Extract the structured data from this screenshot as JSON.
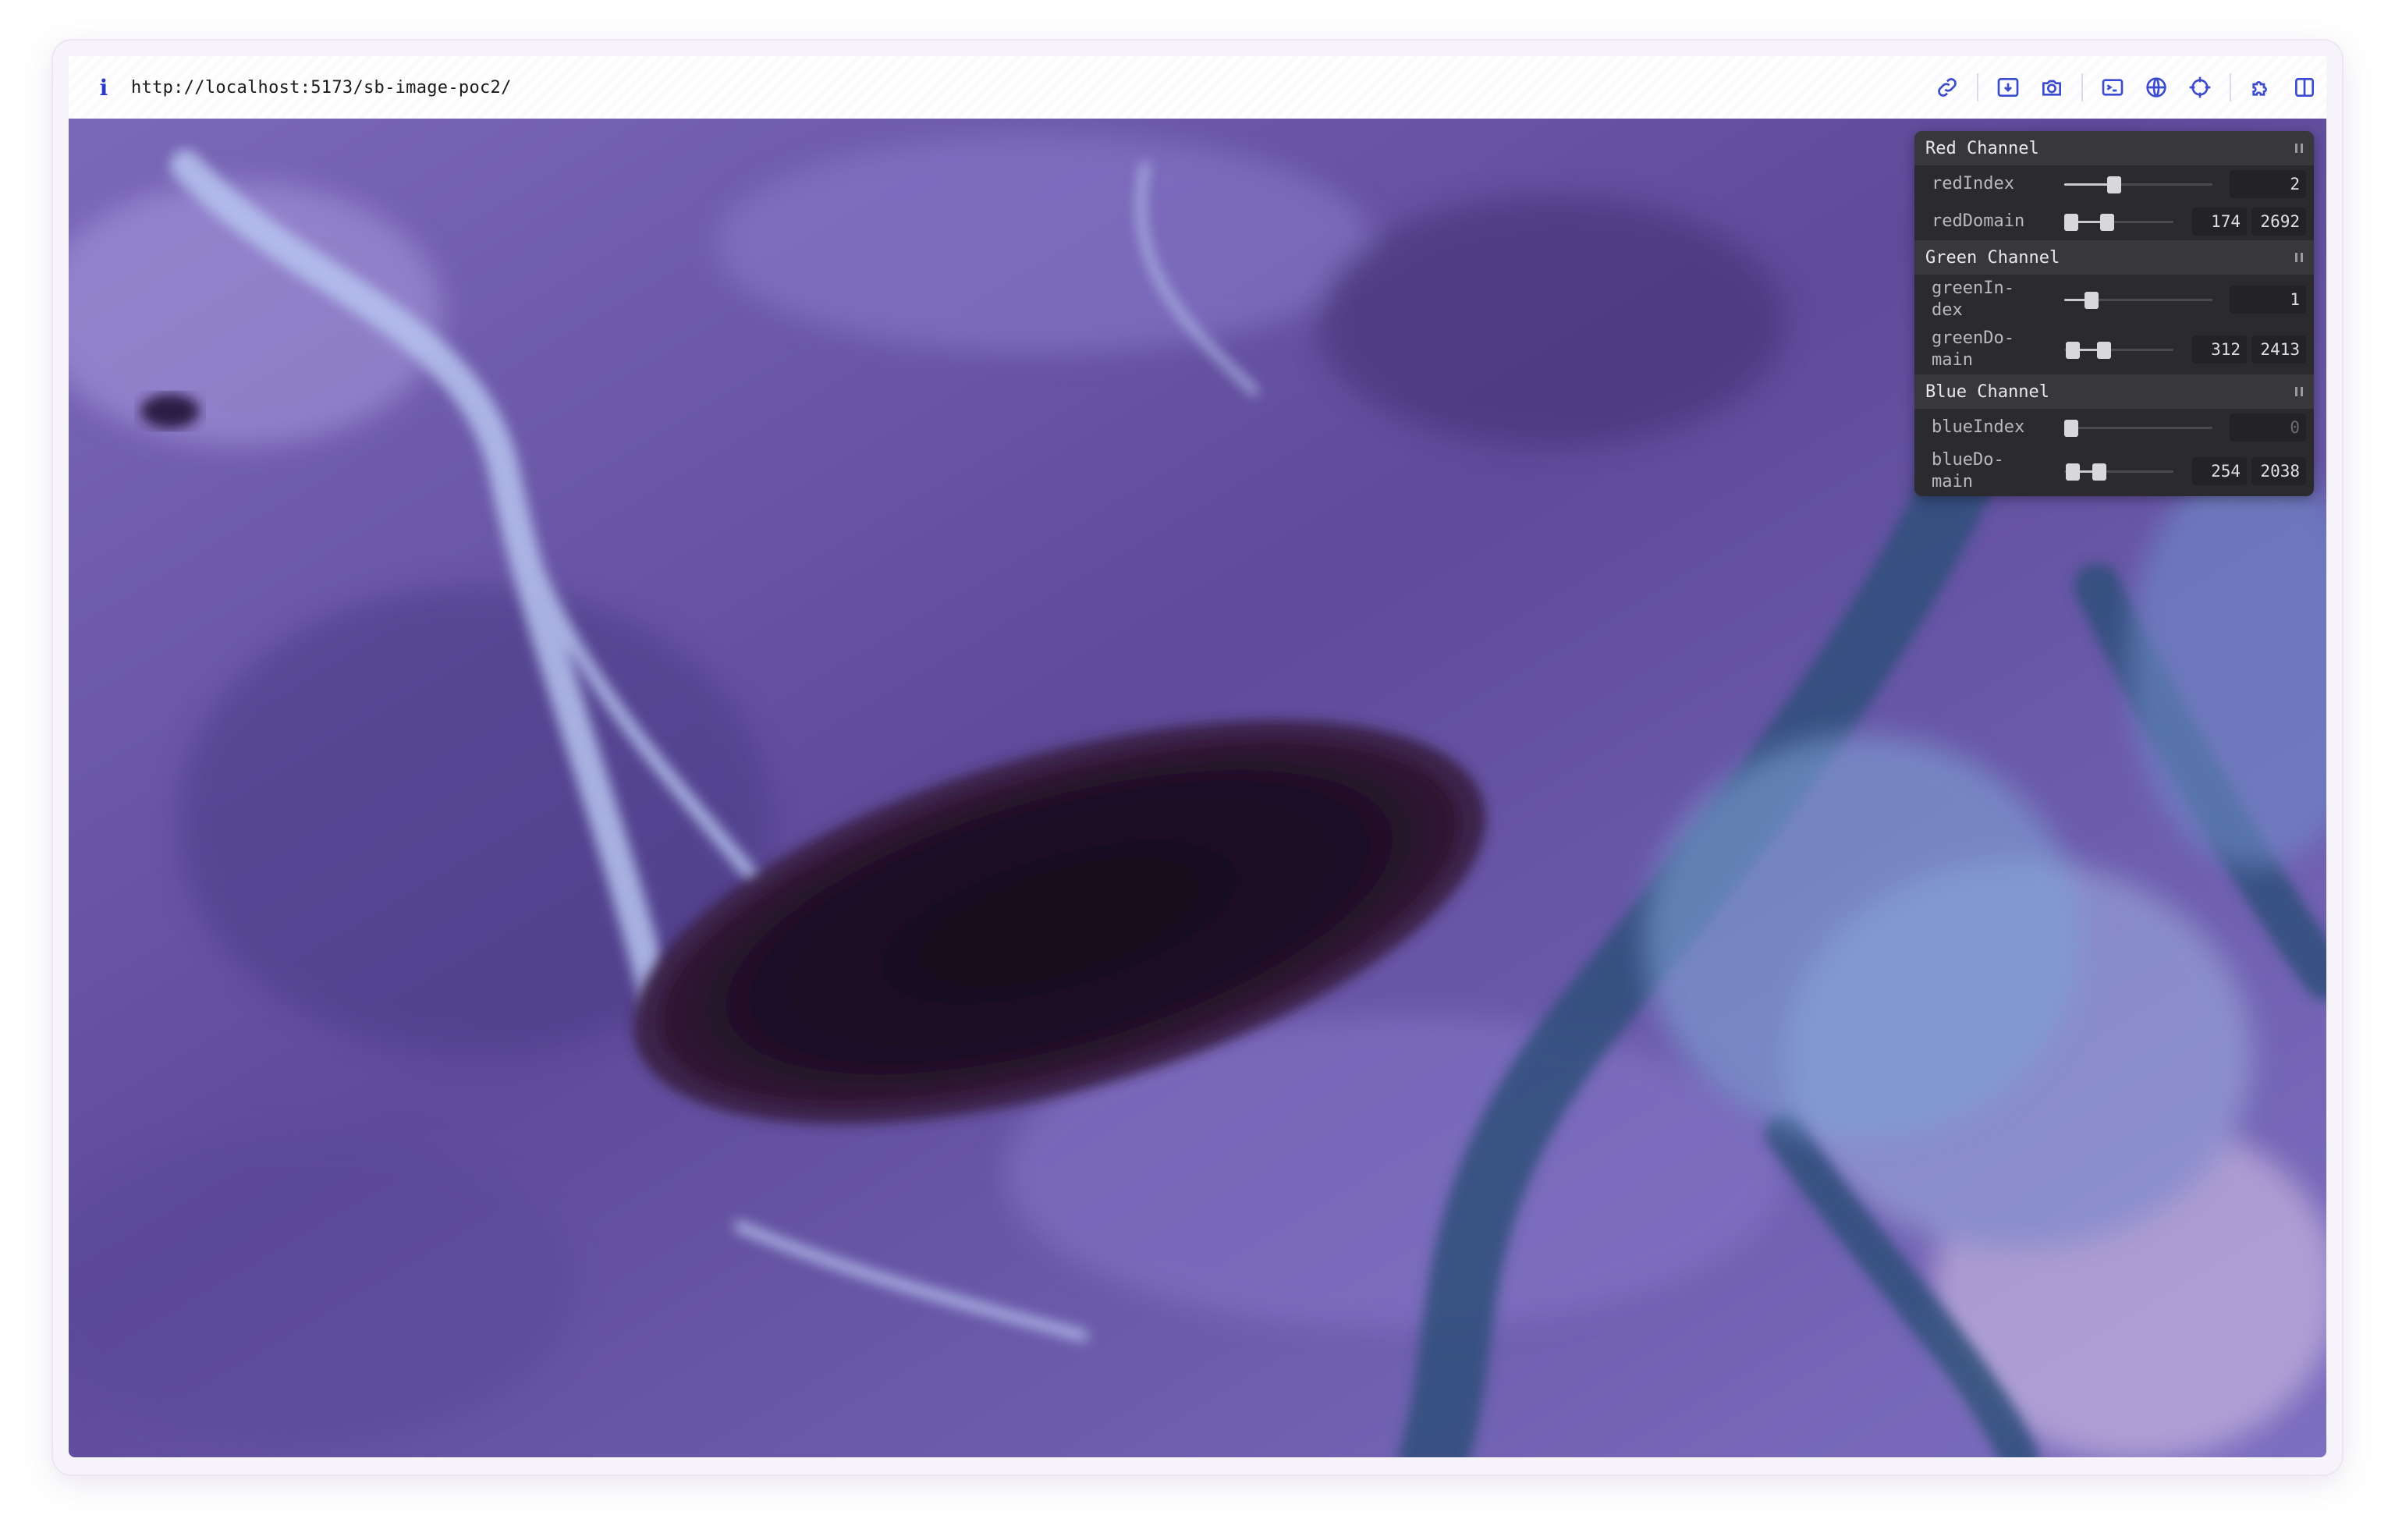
{
  "browser": {
    "url": "http://localhost:5173/sb-image-poc2/",
    "tools": [
      "link-icon",
      "save-image-icon",
      "camera-icon",
      "terminal-icon",
      "globe-icon",
      "crosshair-icon",
      "puzzle-icon",
      "split-view-icon"
    ]
  },
  "panel": {
    "red": {
      "title": "Red Channel",
      "index_label": "redIndex",
      "index_value": "2",
      "domain_label": "redDomain",
      "domain_min": "174",
      "domain_max": "2692"
    },
    "green": {
      "title": "Green Channel",
      "index_label": "greenIn-\ndex",
      "index_value": "1",
      "domain_label": "greenDo-\nmain",
      "domain_min": "312",
      "domain_max": "2413"
    },
    "blue": {
      "title": "Blue Channel",
      "index_label": "blueIndex",
      "index_value": "0",
      "domain_label": "blueDo-\nmain",
      "domain_min": "254",
      "domain_max": "2038"
    }
  },
  "colors": {
    "image_base": "#6a56a8",
    "lake": "#1d0f22",
    "river": "#5b7fb8",
    "panel_bg": "#2b2b2f"
  }
}
